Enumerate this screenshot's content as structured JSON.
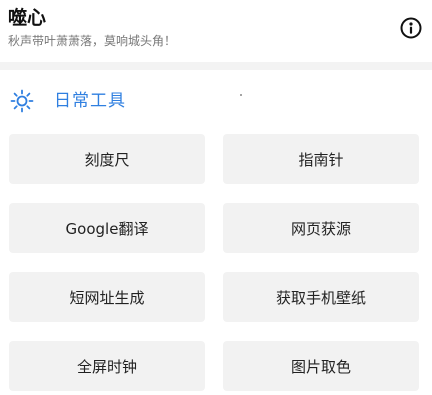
{
  "header": {
    "title": "噬心",
    "subtitle": "秋声带叶萧萧落，莫响城头角！",
    "info_icon": "info-circle-icon"
  },
  "section": {
    "icon": "sun-icon",
    "title": "日常工具",
    "accent_color": "#2f7fe0"
  },
  "tools": [
    {
      "label": "刻度尺"
    },
    {
      "label": "指南针"
    },
    {
      "label": "Google翻译"
    },
    {
      "label": "网页获源"
    },
    {
      "label": "短网址生成"
    },
    {
      "label": "获取手机壁纸"
    },
    {
      "label": "全屏时钟"
    },
    {
      "label": "图片取色"
    }
  ]
}
